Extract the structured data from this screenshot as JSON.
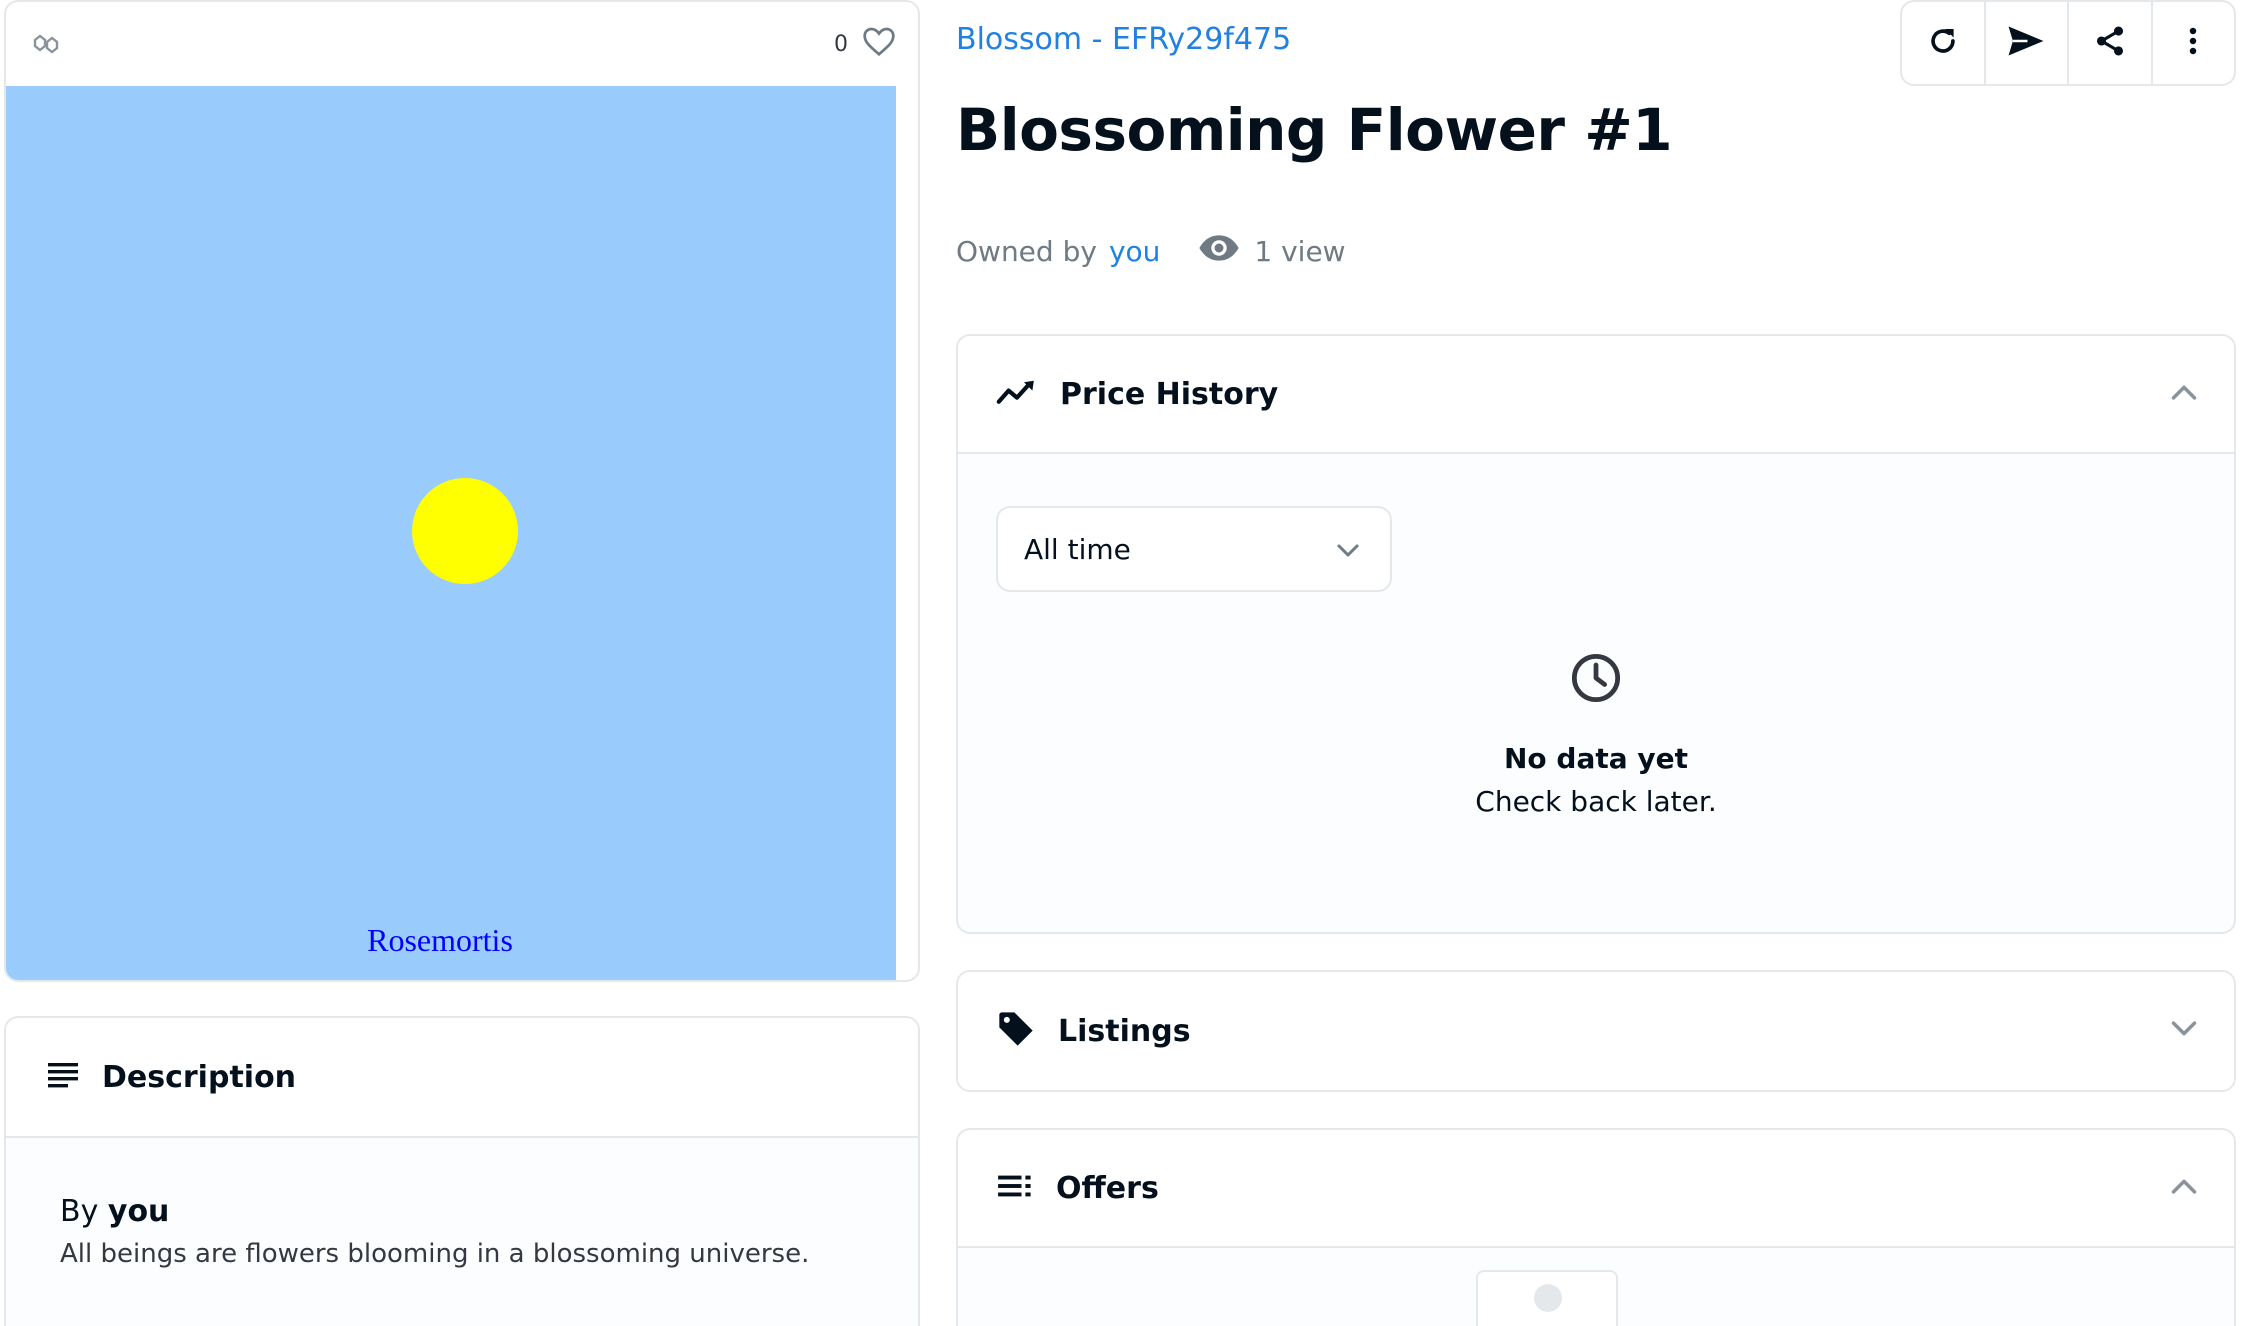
{
  "media": {
    "favorite_count": "0",
    "art_caption": "Rosemortis"
  },
  "description": {
    "title": "Description",
    "by_prefix": "By",
    "by_name": "you",
    "text": "All beings are flowers blooming in a blossoming universe."
  },
  "header": {
    "collection": "Blossom - EFRy29f475",
    "title": "Blossoming Flower #1",
    "owned_by_label": "Owned by",
    "owner": "you",
    "views": "1 view"
  },
  "toolbar": {
    "buttons": [
      "refresh-icon",
      "send-icon",
      "share-icon",
      "more-icon"
    ]
  },
  "price_history": {
    "title": "Price History",
    "filter_value": "All time",
    "empty_title": "No data yet",
    "empty_sub": "Check back later."
  },
  "listings": {
    "title": "Listings"
  },
  "offers": {
    "title": "Offers"
  },
  "colors": {
    "accent": "#2081e2",
    "art_background": "#99cbfd",
    "sun": "#ffff00",
    "caption": "#0000ff"
  }
}
